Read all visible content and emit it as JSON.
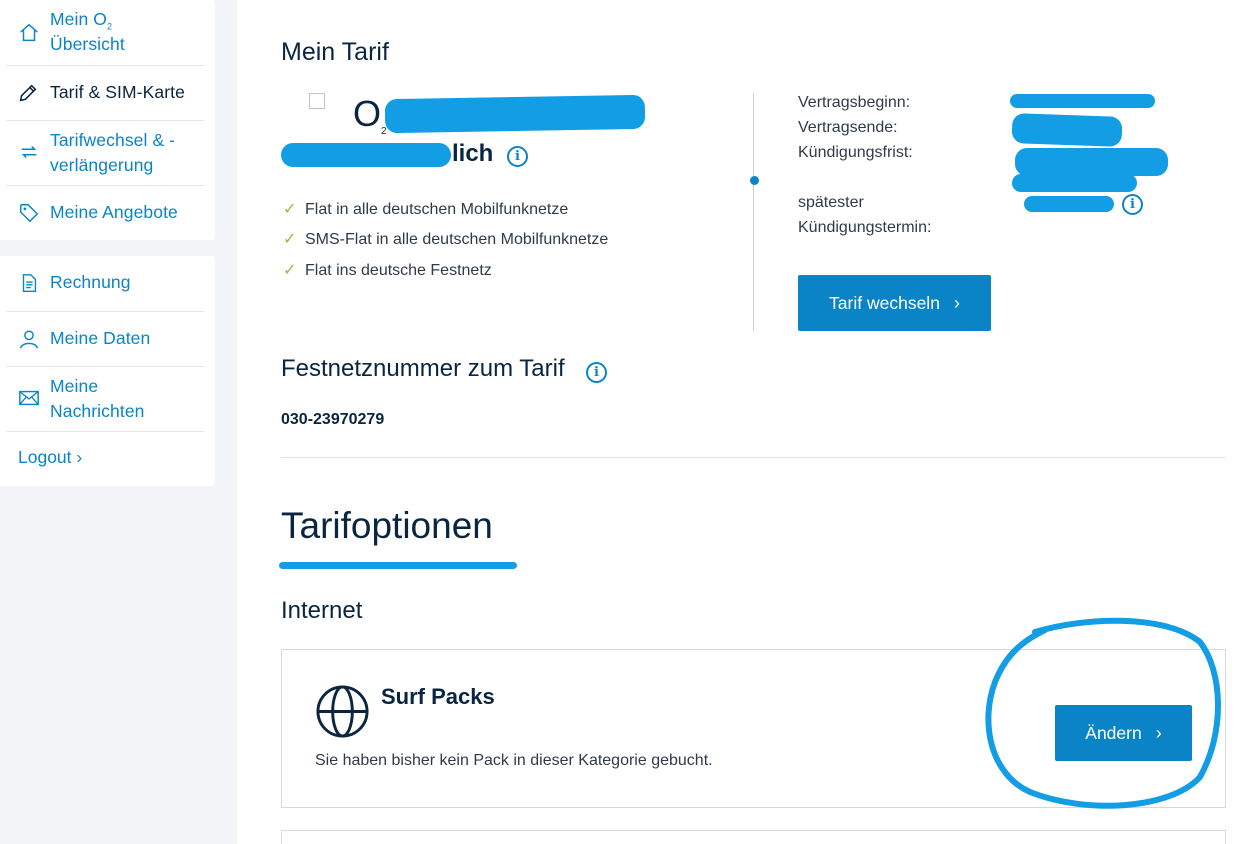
{
  "sidebar": {
    "items": [
      {
        "line1": "Mein O",
        "sub": "2",
        "line2": "Übersicht"
      },
      {
        "label": "Tarif & SIM-Karte"
      },
      {
        "line1": "Tarifwechsel & -",
        "line2": "verlängerung"
      },
      {
        "label": "Meine Angebote"
      }
    ],
    "items2": [
      {
        "label": "Rechnung"
      },
      {
        "label": "Meine Daten"
      },
      {
        "line1": "Meine",
        "line2": "Nachrichten"
      }
    ],
    "logout": "Logout ›"
  },
  "tarif": {
    "heading": "Mein Tarif",
    "brand_letter": "O",
    "brand_sub": "2",
    "name_fragment": "lich",
    "features": [
      "Flat in alle deutschen Mobilfunknetze",
      "SMS-Flat in alle deutschen Mobilfunknetze",
      "Flat ins deutsche Festnetz"
    ],
    "contract": {
      "start_label": "Vertragsbeginn:",
      "end_label": "Vertragsende:",
      "notice_label": "Kündigungsfrist:",
      "latest_label_1": "spätester",
      "latest_label_2": "Kündigungstermin:"
    },
    "change_button": "Tarif wechseln"
  },
  "festnetz": {
    "heading": "Festnetznummer zum Tarif",
    "number": "030-23970279"
  },
  "options": {
    "heading": "Tarifoptionen",
    "internet_heading": "Internet",
    "surf_title": "Surf Packs",
    "surf_text": "Sie haben bisher kein Pack in dieser Kategorie gebucht.",
    "change_button": "Ändern"
  },
  "icons": {
    "home": "home-icon",
    "pencil": "pencil-icon",
    "swap": "swap-icon",
    "tag": "tag-icon",
    "document": "document-icon",
    "user": "user-icon",
    "mail": "mail-icon",
    "globe": "globe-icon",
    "info": "info-icon",
    "check": "check-icon"
  },
  "colors": {
    "accent": "#0a84c6",
    "heading": "#0a2540",
    "check": "#8cbf3f",
    "scribble": "#129de4",
    "sidebar_bg": "#f2f4f7"
  }
}
